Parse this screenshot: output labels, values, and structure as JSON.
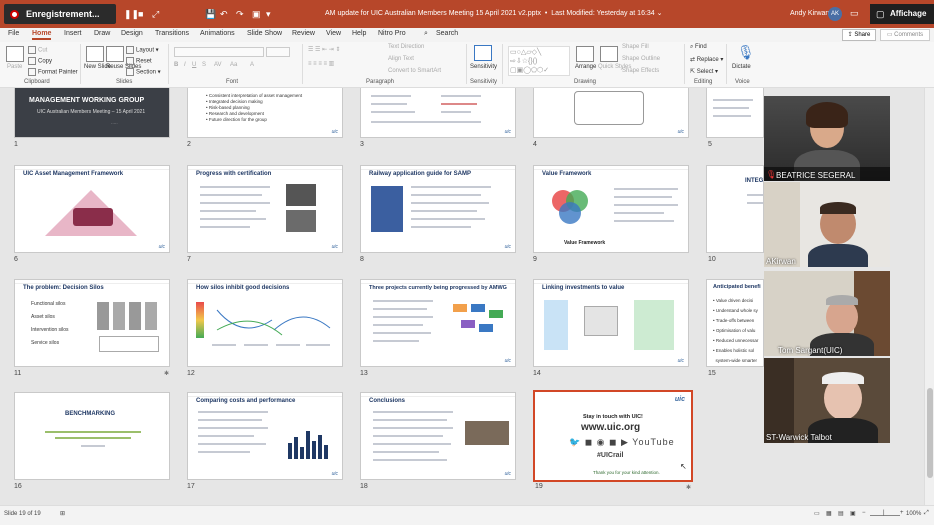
{
  "titlebar": {
    "recording_label": "Enregistrement...",
    "doc_title": "AM update for UIC Australian Members Meeting 15 April 2021 v2.pptx",
    "last_modified": "Last Modified: Yesterday at 16:34",
    "user_name": "Andy Kirwan",
    "user_initials": "AK",
    "affichage_label": "Affichage"
  },
  "tabs": [
    "File",
    "Home",
    "Insert",
    "Draw",
    "Design",
    "Transitions",
    "Animations",
    "Slide Show",
    "Review",
    "View",
    "Help",
    "Nitro Pro",
    "Search"
  ],
  "active_tab": "Home",
  "share_label": "Share",
  "comments_label": "Comments",
  "ribbon": {
    "clipboard": {
      "paste": "Paste",
      "cut": "Cut",
      "copy": "Copy",
      "format_painter": "Format Painter",
      "label": "Clipboard"
    },
    "slides": {
      "new_slide": "New Slide",
      "reuse_slides": "Reuse Slides",
      "layout": "Layout",
      "reset": "Reset",
      "section": "Section",
      "label": "Slides"
    },
    "font": {
      "label": "Font"
    },
    "paragraph": {
      "text_direction": "Text Direction",
      "align_text": "Align Text",
      "convert_smartart": "Convert to SmartArt",
      "label": "Paragraph"
    },
    "sensitivity": {
      "button": "Sensitivity",
      "label": "Sensitivity"
    },
    "drawing": {
      "arrange": "Arrange",
      "quick_styles": "Quick Styles",
      "shape_fill": "Shape Fill",
      "shape_outline": "Shape Outline",
      "shape_effects": "Shape Effects",
      "label": "Drawing"
    },
    "editing": {
      "find": "Find",
      "replace": "Replace",
      "select": "Select",
      "label": "Editing"
    },
    "voice": {
      "dictate": "Dictate",
      "label": "Voice"
    }
  },
  "slides": [
    {
      "num": "1",
      "title": "MANAGEMENT WORKING GROUP",
      "subtitle": "UIC Australian Members Meeting – 15 April 2021"
    },
    {
      "num": "2",
      "lines": [
        "Consistent interpretation of asset management",
        "Integrated decision making",
        "Risk-based planning",
        "Research and development",
        "Future direction for the group"
      ]
    },
    {
      "num": "3"
    },
    {
      "num": "4"
    },
    {
      "num": "5"
    },
    {
      "num": "6",
      "title": "UIC Asset Management Framework"
    },
    {
      "num": "7",
      "title": "Progress with certification"
    },
    {
      "num": "8",
      "title": "Railway application guide for SAMP"
    },
    {
      "num": "9",
      "title": "Value Framework",
      "caption": "Value Framework"
    },
    {
      "num": "10",
      "title": "INTEG"
    },
    {
      "num": "11",
      "title": "The problem: Decision Silos",
      "lines": [
        "Functional silos",
        "Asset silos",
        "Intervention silos",
        "Service silos"
      ]
    },
    {
      "num": "12",
      "title": "How silos inhibit good decisions"
    },
    {
      "num": "13",
      "title": "Three projects currently being progressed by AMWG"
    },
    {
      "num": "14",
      "title": "Linking investments to value"
    },
    {
      "num": "15",
      "title": "Anticipated benefi",
      "lines": [
        "Value driven decisi",
        "Understand whole sy",
        "Trade-offs between",
        "Optimisation of valu",
        "Reduced unnecessar",
        "Enables holistic sol",
        "system-wide smarter"
      ]
    },
    {
      "num": "16",
      "title": "BENCHMARKING"
    },
    {
      "num": "17",
      "title": "Comparing costs and performance"
    },
    {
      "num": "18",
      "title": "Conclusions"
    },
    {
      "num": "19",
      "title": "Stay in touch with UIC!",
      "url": "www.uic.org",
      "hashtag": "#UICrail",
      "thanks": "Thank you for your kind attention."
    }
  ],
  "participants": [
    {
      "name": "BEATRICE SEGERAL",
      "muted": true
    },
    {
      "name": "AKirwan",
      "muted": false
    },
    {
      "name": "Tom Sargant(UIC)",
      "muted": false
    },
    {
      "name": "ST-Warwick Talbot",
      "muted": false
    }
  ],
  "status": {
    "slide_info": "Slide 19 of 19",
    "zoom": "100%"
  },
  "colors": {
    "accent": "#b7472a",
    "selection": "#d24726",
    "uic_blue": "#3b6aa0"
  }
}
